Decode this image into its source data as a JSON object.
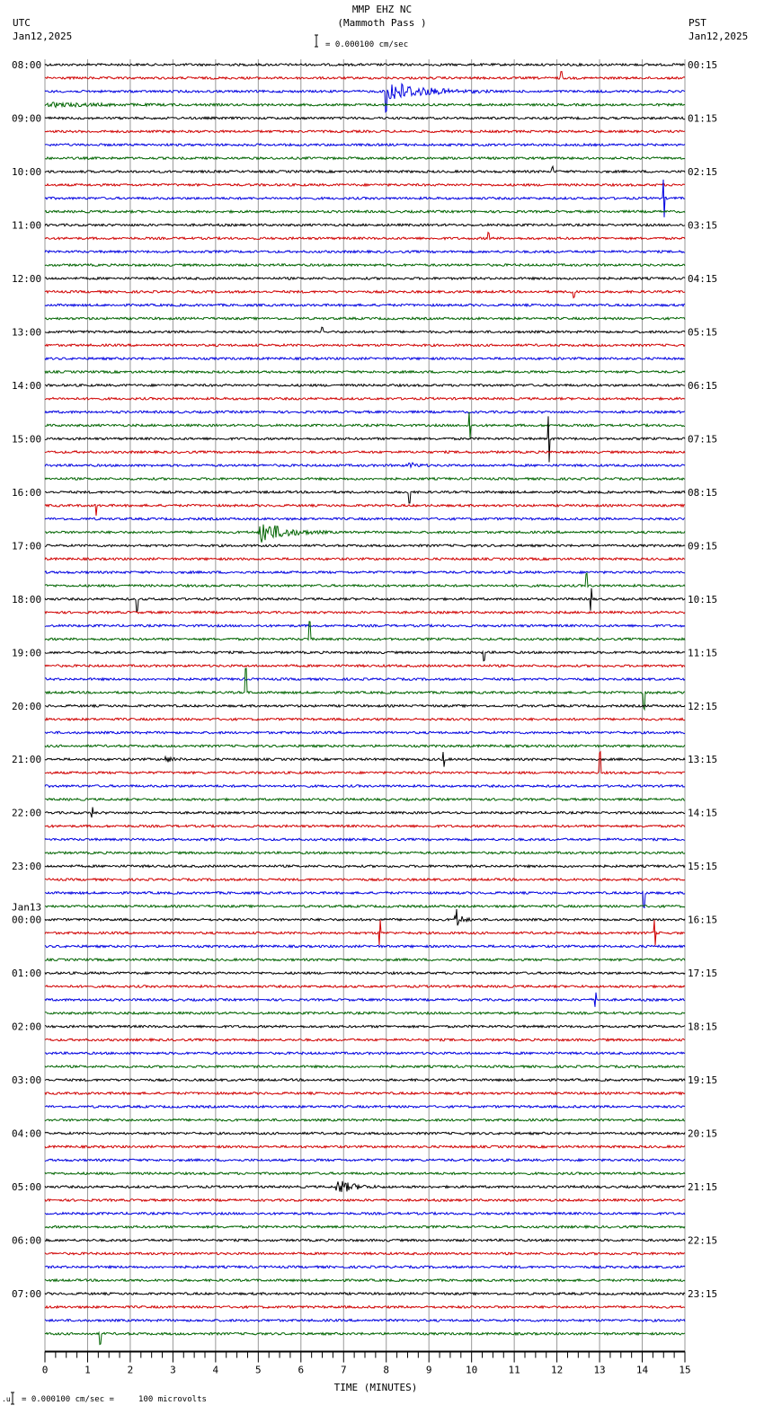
{
  "header": {
    "title": "MMP EHZ NC",
    "subtitle": "(Mammoth Pass )",
    "scale": "= 0.000100 cm/sec",
    "left_tz": "UTC",
    "left_date": "Jan12,2025",
    "right_tz": "PST",
    "right_date": "Jan12,2025"
  },
  "footer": {
    "scale_note": "= 0.000100 cm/sec =     100 microvolts"
  },
  "chart_data": {
    "type": "line",
    "title": "MMP EHZ NC (Mammoth Pass )",
    "xlabel": "TIME (MINUTES)",
    "xlim": [
      0,
      15
    ],
    "x_ticks": [
      "0",
      "1",
      "2",
      "3",
      "4",
      "5",
      "6",
      "7",
      "8",
      "9",
      "10",
      "11",
      "12",
      "13",
      "14",
      "15"
    ],
    "traces_per_hour": 4,
    "trace_colors": [
      "#000000",
      "#d00000",
      "#0000e0",
      "#006400"
    ],
    "left_labels": [
      "08:00",
      "09:00",
      "10:00",
      "11:00",
      "12:00",
      "13:00",
      "14:00",
      "15:00",
      "16:00",
      "17:00",
      "18:00",
      "19:00",
      "20:00",
      "21:00",
      "22:00",
      "23:00",
      "00:00",
      "01:00",
      "02:00",
      "03:00",
      "04:00",
      "05:00",
      "06:00",
      "07:00"
    ],
    "left_date_change": {
      "hour_index": 16,
      "label": "Jan13"
    },
    "right_labels": [
      "00:15",
      "01:15",
      "02:15",
      "03:15",
      "04:15",
      "05:15",
      "06:15",
      "07:15",
      "08:15",
      "09:15",
      "10:15",
      "11:15",
      "12:15",
      "13:15",
      "14:15",
      "15:15",
      "16:15",
      "17:15",
      "18:15",
      "19:15",
      "20:15",
      "21:15",
      "22:15",
      "23:15"
    ],
    "events": [
      {
        "trace": 2,
        "minute": 8.0,
        "duration": 2.6,
        "amplitude": 14
      },
      {
        "trace": 3,
        "minute": 0.0,
        "duration": 4.2,
        "amplitude": 2
      },
      {
        "trace": 30,
        "minute": 8.5,
        "duration": 0.6,
        "amplitude": 4
      },
      {
        "trace": 35,
        "minute": 5.0,
        "duration": 1.8,
        "amplitude": 16
      },
      {
        "trace": 52,
        "minute": 2.8,
        "duration": 0.6,
        "amplitude": 4
      },
      {
        "trace": 84,
        "minute": 6.8,
        "duration": 1.2,
        "amplitude": 10
      },
      {
        "trace": 64,
        "minute": 9.6,
        "duration": 0.4,
        "amplitude": 18
      }
    ],
    "spikes": [
      {
        "trace": 1,
        "minute": 12.1,
        "amplitude": 8
      },
      {
        "trace": 2,
        "minute": 8.0,
        "amplitude": 22
      },
      {
        "trace": 8,
        "minute": 11.9,
        "amplitude": 5
      },
      {
        "trace": 10,
        "minute": 14.5,
        "amplitude": 20
      },
      {
        "trace": 13,
        "minute": 10.4,
        "amplitude": 6
      },
      {
        "trace": 17,
        "minute": 12.4,
        "amplitude": 6
      },
      {
        "trace": 20,
        "minute": 6.5,
        "amplitude": 6
      },
      {
        "trace": 27,
        "minute": 9.95,
        "amplitude": 14
      },
      {
        "trace": 28,
        "minute": 11.8,
        "amplitude": 26
      },
      {
        "trace": 32,
        "minute": 8.55,
        "amplitude": 12
      },
      {
        "trace": 33,
        "minute": 1.2,
        "amplitude": 12
      },
      {
        "trace": 39,
        "minute": 12.7,
        "amplitude": 14
      },
      {
        "trace": 40,
        "minute": 2.15,
        "amplitude": 14
      },
      {
        "trace": 40,
        "minute": 12.8,
        "amplitude": 12
      },
      {
        "trace": 43,
        "minute": 6.2,
        "amplitude": 20
      },
      {
        "trace": 44,
        "minute": 10.3,
        "amplitude": 10
      },
      {
        "trace": 47,
        "minute": 4.7,
        "amplitude": 26
      },
      {
        "trace": 47,
        "minute": 14.05,
        "amplitude": 18
      },
      {
        "trace": 52,
        "minute": 9.35,
        "amplitude": 8
      },
      {
        "trace": 53,
        "minute": 13.0,
        "amplitude": 22
      },
      {
        "trace": 56,
        "minute": 1.1,
        "amplitude": 6
      },
      {
        "trace": 62,
        "minute": 14.05,
        "amplitude": 16
      },
      {
        "trace": 65,
        "minute": 7.85,
        "amplitude": 14
      },
      {
        "trace": 65,
        "minute": 14.3,
        "amplitude": 14
      },
      {
        "trace": 70,
        "minute": 12.9,
        "amplitude": 8
      },
      {
        "trace": 95,
        "minute": 1.3,
        "amplitude": 12
      }
    ]
  }
}
